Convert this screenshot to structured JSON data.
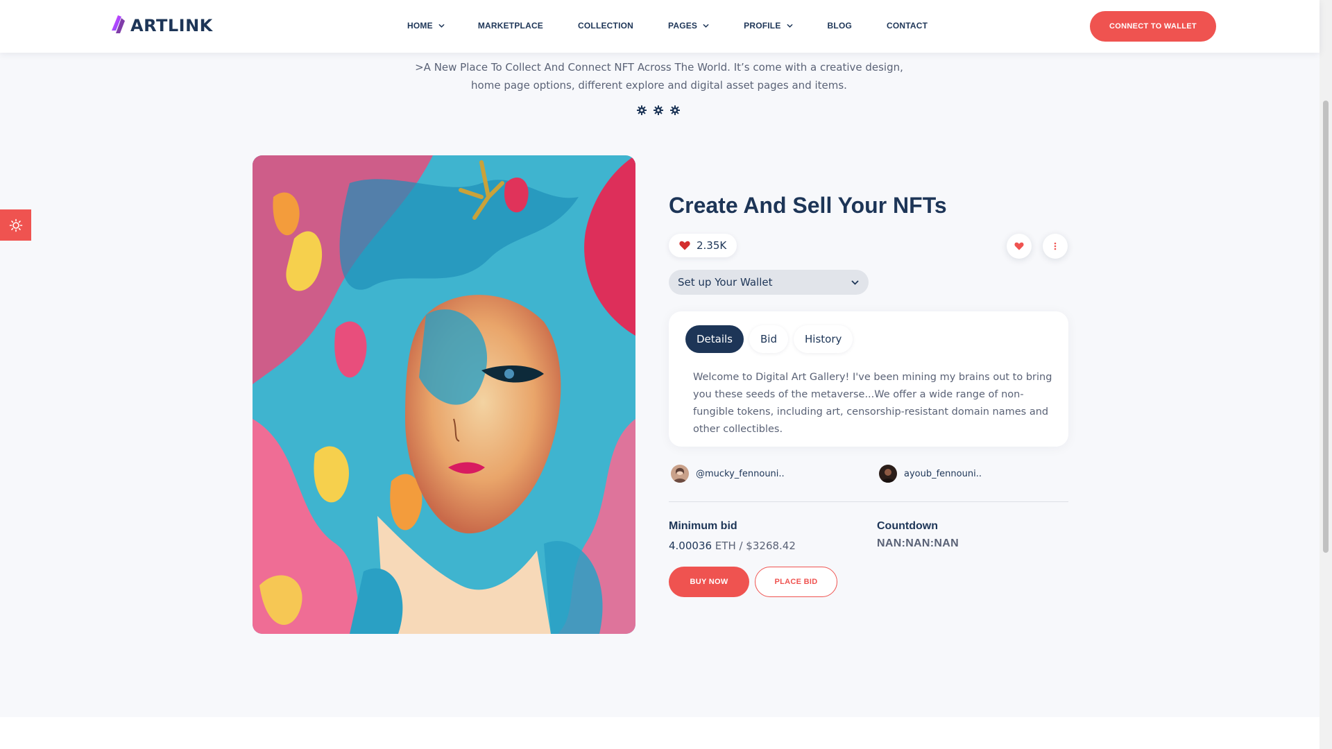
{
  "brand": {
    "name": "ARTLINK",
    "accent": "#ef5350",
    "navy": "#1d3557",
    "logo_gradient": [
      "#7c4dff",
      "#e040fb"
    ]
  },
  "nav": {
    "items": [
      {
        "label": "HOME",
        "has_dropdown": true
      },
      {
        "label": "MARKETPLACE",
        "has_dropdown": false
      },
      {
        "label": "COLLECTION",
        "has_dropdown": false
      },
      {
        "label": "PAGES",
        "has_dropdown": true
      },
      {
        "label": "PROFILE",
        "has_dropdown": true
      },
      {
        "label": "BLOG",
        "has_dropdown": false
      },
      {
        "label": "CONTACT",
        "has_dropdown": false
      }
    ],
    "connect_label": "CONNECT TO WALLET"
  },
  "theme_toggle": {
    "icon": "sun-icon"
  },
  "intro": {
    "line1": ">A New Place To Collect And Connect NFT Across The World. It’s come with a creative design,",
    "line2": "home page options, different explore and digital asset pages and items.",
    "ornament_icon": "gear-icon"
  },
  "item": {
    "title": "Create And Sell Your NFTs",
    "likes": "2.35K",
    "wallet_select": {
      "selected": "Set up Your Wallet"
    },
    "tabs": [
      {
        "label": "Details",
        "active": true
      },
      {
        "label": "Bid",
        "active": false
      },
      {
        "label": "History",
        "active": false
      }
    ],
    "description": "Welcome to Digital Art Gallery! I've been mining my brains out to bring you these seeds of the metaverse...We offer a wide range of non-fungible tokens, including art, censorship-resistant domain names and other collectibles.",
    "creator": "@mucky_fennouni..",
    "owner": "ayoub_fennouni..",
    "min_bid_label": "Minimum bid",
    "min_bid_eth": "4.00036",
    "min_bid_rest": " ETH / $3268.42",
    "countdown_label": "Countdown",
    "countdown": "NAN:NAN:NAN",
    "buy_label": "BUY NOW",
    "bid_label": "PLACE BID"
  }
}
